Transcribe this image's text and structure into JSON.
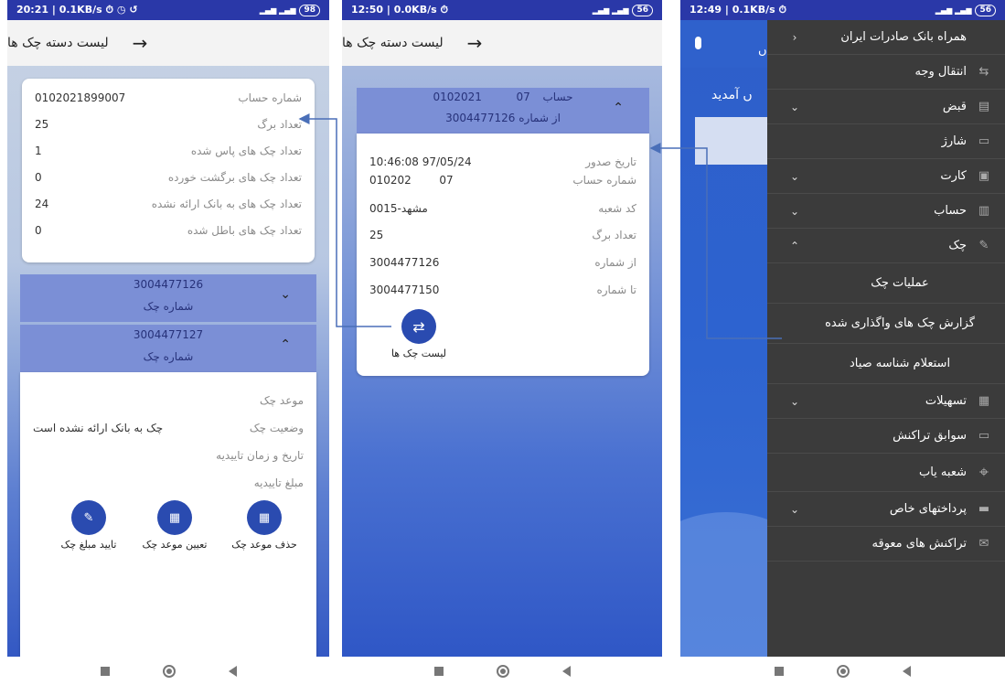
{
  "phone1": {
    "status": {
      "time": "20:21 | 0.1KB/s",
      "icons": "⏱ ◷ ↺",
      "signal": "▂▄▆ ▂▄▆",
      "battery": "98"
    },
    "title": "لیست دسته چک ها",
    "back_arrow": "→",
    "info": [
      {
        "label": "شماره حساب",
        "value": "0102021899007"
      },
      {
        "label": "تعداد برگ",
        "value": "25"
      },
      {
        "label": "تعداد چک های پاس شده",
        "value": "1"
      },
      {
        "label": "تعداد چک های برگشت خورده",
        "value": "0"
      },
      {
        "label": "تعداد چک های به بانک ارائه نشده",
        "value": "24"
      },
      {
        "label": "تعداد چک های باطل شده",
        "value": "0"
      }
    ],
    "cheque1": {
      "number": "3004477126",
      "label": "شماره چک",
      "chevron": "⌄"
    },
    "cheque2": {
      "number": "3004477127",
      "label": "شماره چک",
      "chevron": "⌃"
    },
    "details": [
      {
        "label": "موعد چک",
        "value": ""
      },
      {
        "label": "وضعیت چک",
        "value": "چک به بانک ارائه نشده است"
      },
      {
        "label": "تاریخ و زمان تاییدیه",
        "value": ""
      },
      {
        "label": "مبلغ تاییدیه",
        "value": ""
      }
    ],
    "actions": [
      {
        "label": "حذف موعد چک",
        "icon": "▦"
      },
      {
        "label": "تعیین موعد چک",
        "icon": "▦"
      },
      {
        "label": "تایید مبلغ چک",
        "icon": "✎"
      }
    ]
  },
  "phone2": {
    "status": {
      "time": "12:50 | 0.0KB/s",
      "icons": "⏱",
      "signal": "▂▄▆ ▂▄▆",
      "battery": "56"
    },
    "title": "لیست دسته چک ها",
    "back_arrow": "→",
    "header": {
      "account_label": "حساب",
      "account_num": "0102021",
      "account_suffix": "07",
      "from_label": "از شماره",
      "from_num": "3004477126",
      "chevron": "⌃"
    },
    "info": [
      {
        "label": "تاریخ صدور",
        "value": "10:46:08  97/05/24"
      },
      {
        "label": "شماره حساب",
        "value": "010202        07"
      },
      {
        "label": "کد شعبه",
        "value": "مشهد-0015"
      },
      {
        "label": "تعداد برگ",
        "value": "25"
      },
      {
        "label": "از شماره",
        "value": "3004477126"
      },
      {
        "label": "تا شماره",
        "value": "3004477150"
      }
    ],
    "list_button": {
      "label": "لیست چک ها",
      "icon": "⇄"
    }
  },
  "phone3": {
    "status": {
      "time": "12:49 | 0.1KB/s",
      "icons": "⏱",
      "signal": "▂▄▆ ▂▄▆",
      "battery": "56"
    },
    "background": {
      "welcome": "ں آمدید",
      "partial": "ں"
    },
    "menu": [
      {
        "label": "همراه بانک صادرات ایران",
        "icon": "",
        "expander": "‹"
      },
      {
        "label": "انتقال وجه",
        "icon": "⇆",
        "expander": ""
      },
      {
        "label": "قبض",
        "icon": "▤",
        "expander": "⌄"
      },
      {
        "label": "شارژ",
        "icon": "▭",
        "expander": ""
      },
      {
        "label": "کارت",
        "icon": "▣",
        "expander": "⌄"
      },
      {
        "label": "حساب",
        "icon": "▥",
        "expander": "⌄"
      },
      {
        "label": "چک",
        "icon": "✎",
        "expander": "⌃"
      },
      {
        "label": "عملیات چک",
        "icon": "",
        "expander": ""
      },
      {
        "label": "گزارش چک های واگذاری شده",
        "icon": "",
        "expander": ""
      },
      {
        "label": "استعلام شناسه صیاد",
        "icon": "",
        "expander": ""
      },
      {
        "label": "تسهیلات",
        "icon": "▦",
        "expander": "⌄"
      },
      {
        "label": "سوابق تراکنش",
        "icon": "▭",
        "expander": ""
      },
      {
        "label": "شعبه یاب",
        "icon": "⌖",
        "expander": ""
      },
      {
        "label": "پرداختهای خاص",
        "icon": "▬",
        "expander": "⌄"
      },
      {
        "label": "تراکنش های معوقه",
        "icon": "✉",
        "expander": ""
      }
    ]
  }
}
